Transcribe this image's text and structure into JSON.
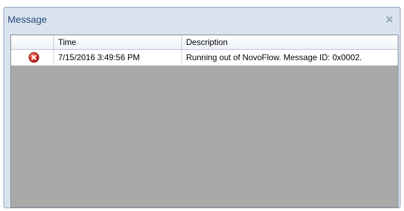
{
  "window": {
    "title": "Message"
  },
  "grid": {
    "columns": [
      {
        "label": ""
      },
      {
        "label": "Time"
      },
      {
        "label": "Description"
      }
    ],
    "rows": [
      {
        "icon": "error-icon",
        "time": "7/15/2016 3:49:56 PM",
        "description": "Running out of NovoFlow. Message ID: 0x0002."
      }
    ]
  },
  "colors": {
    "title_text": "#2a4a7a",
    "window_bg": "#d9e3ef",
    "grid_empty_bg": "#a9a9a9",
    "error_red": "#d9332b"
  }
}
